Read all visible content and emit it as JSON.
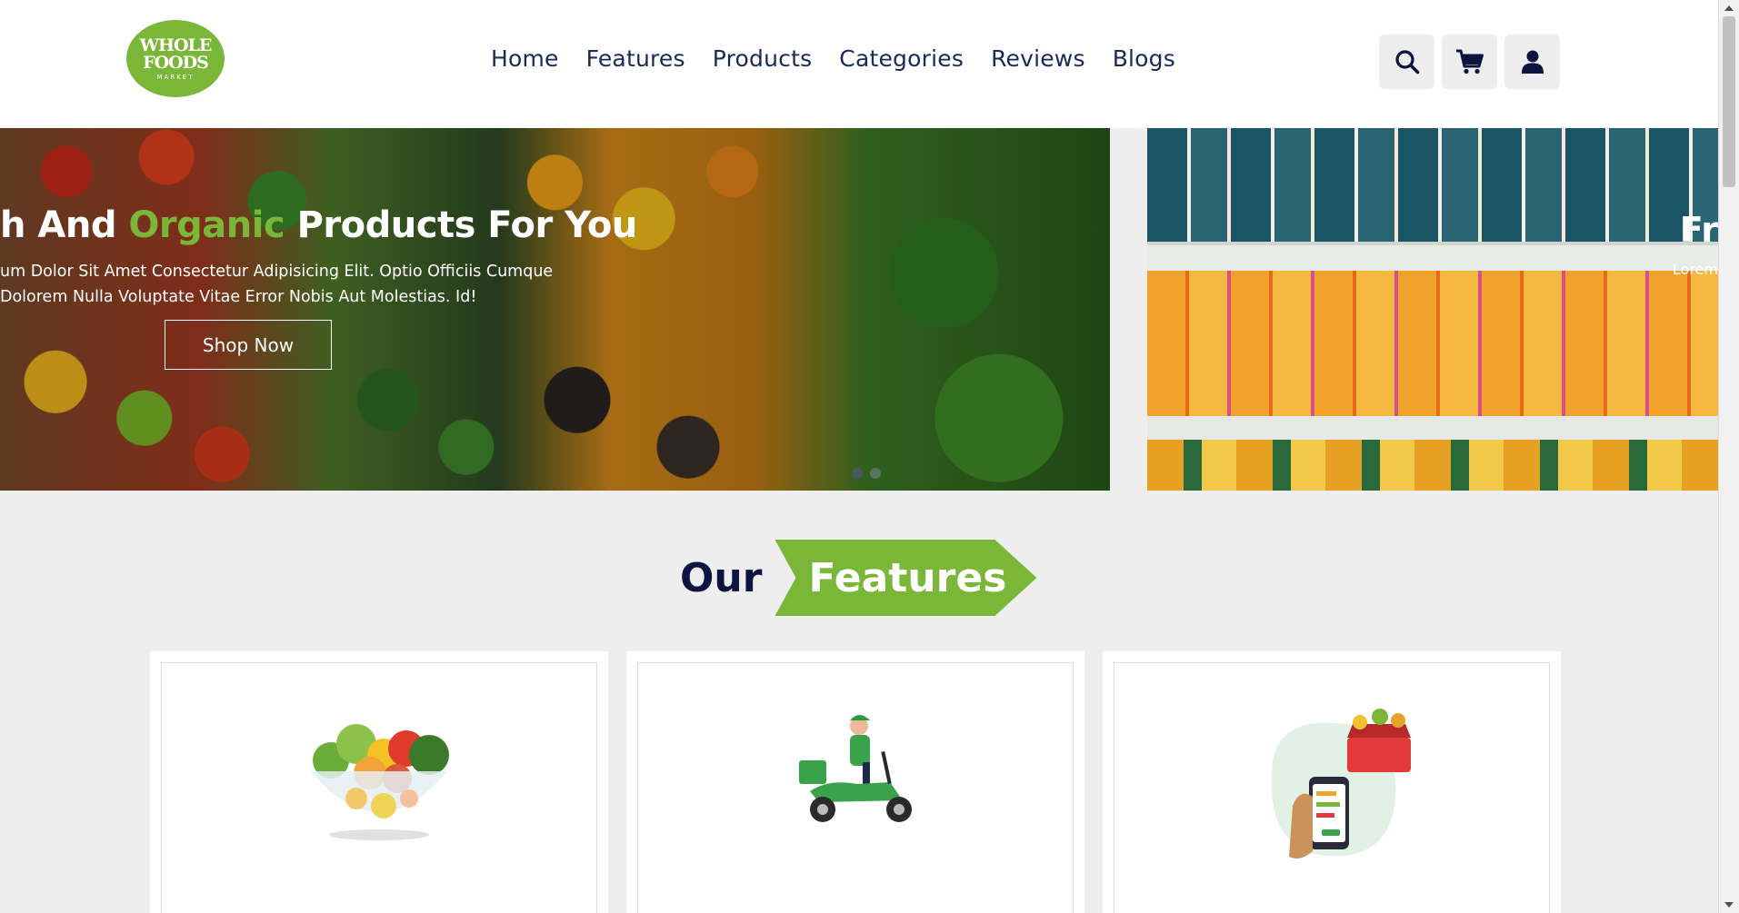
{
  "logo": {
    "line1": "WHOLE",
    "line2": "FOODS",
    "line3": "MARKET"
  },
  "nav": {
    "items": [
      "Home",
      "Features",
      "Products",
      "Categories",
      "Reviews",
      "Blogs"
    ]
  },
  "header_icons": [
    "search-icon",
    "shopping-cart-icon",
    "user-icon"
  ],
  "hero": {
    "slide1": {
      "title_part1": "h And ",
      "title_highlight": "Organic",
      "title_part2": " Products For You",
      "description": "um Dolor Sit Amet Consectetur Adipisicing Elit. Optio Officiis Cumque Dolorem Nulla Voluptate Vitae Error Nobis Aut Molestias. Id!",
      "button": "Shop Now"
    },
    "slide2": {
      "title_fragment": "Fr",
      "description_fragment": "Lorem"
    },
    "dots": 2
  },
  "features": {
    "heading_dark": "Our",
    "heading_tag": "Features",
    "cards": [
      "salad-bowl-illustration",
      "delivery-scooter-illustration",
      "phone-grocery-basket-illustration"
    ]
  },
  "colors": {
    "accent": "#7ab738",
    "navy": "#0d1440",
    "nav_text": "#192a56",
    "background": "#eeeeee"
  }
}
